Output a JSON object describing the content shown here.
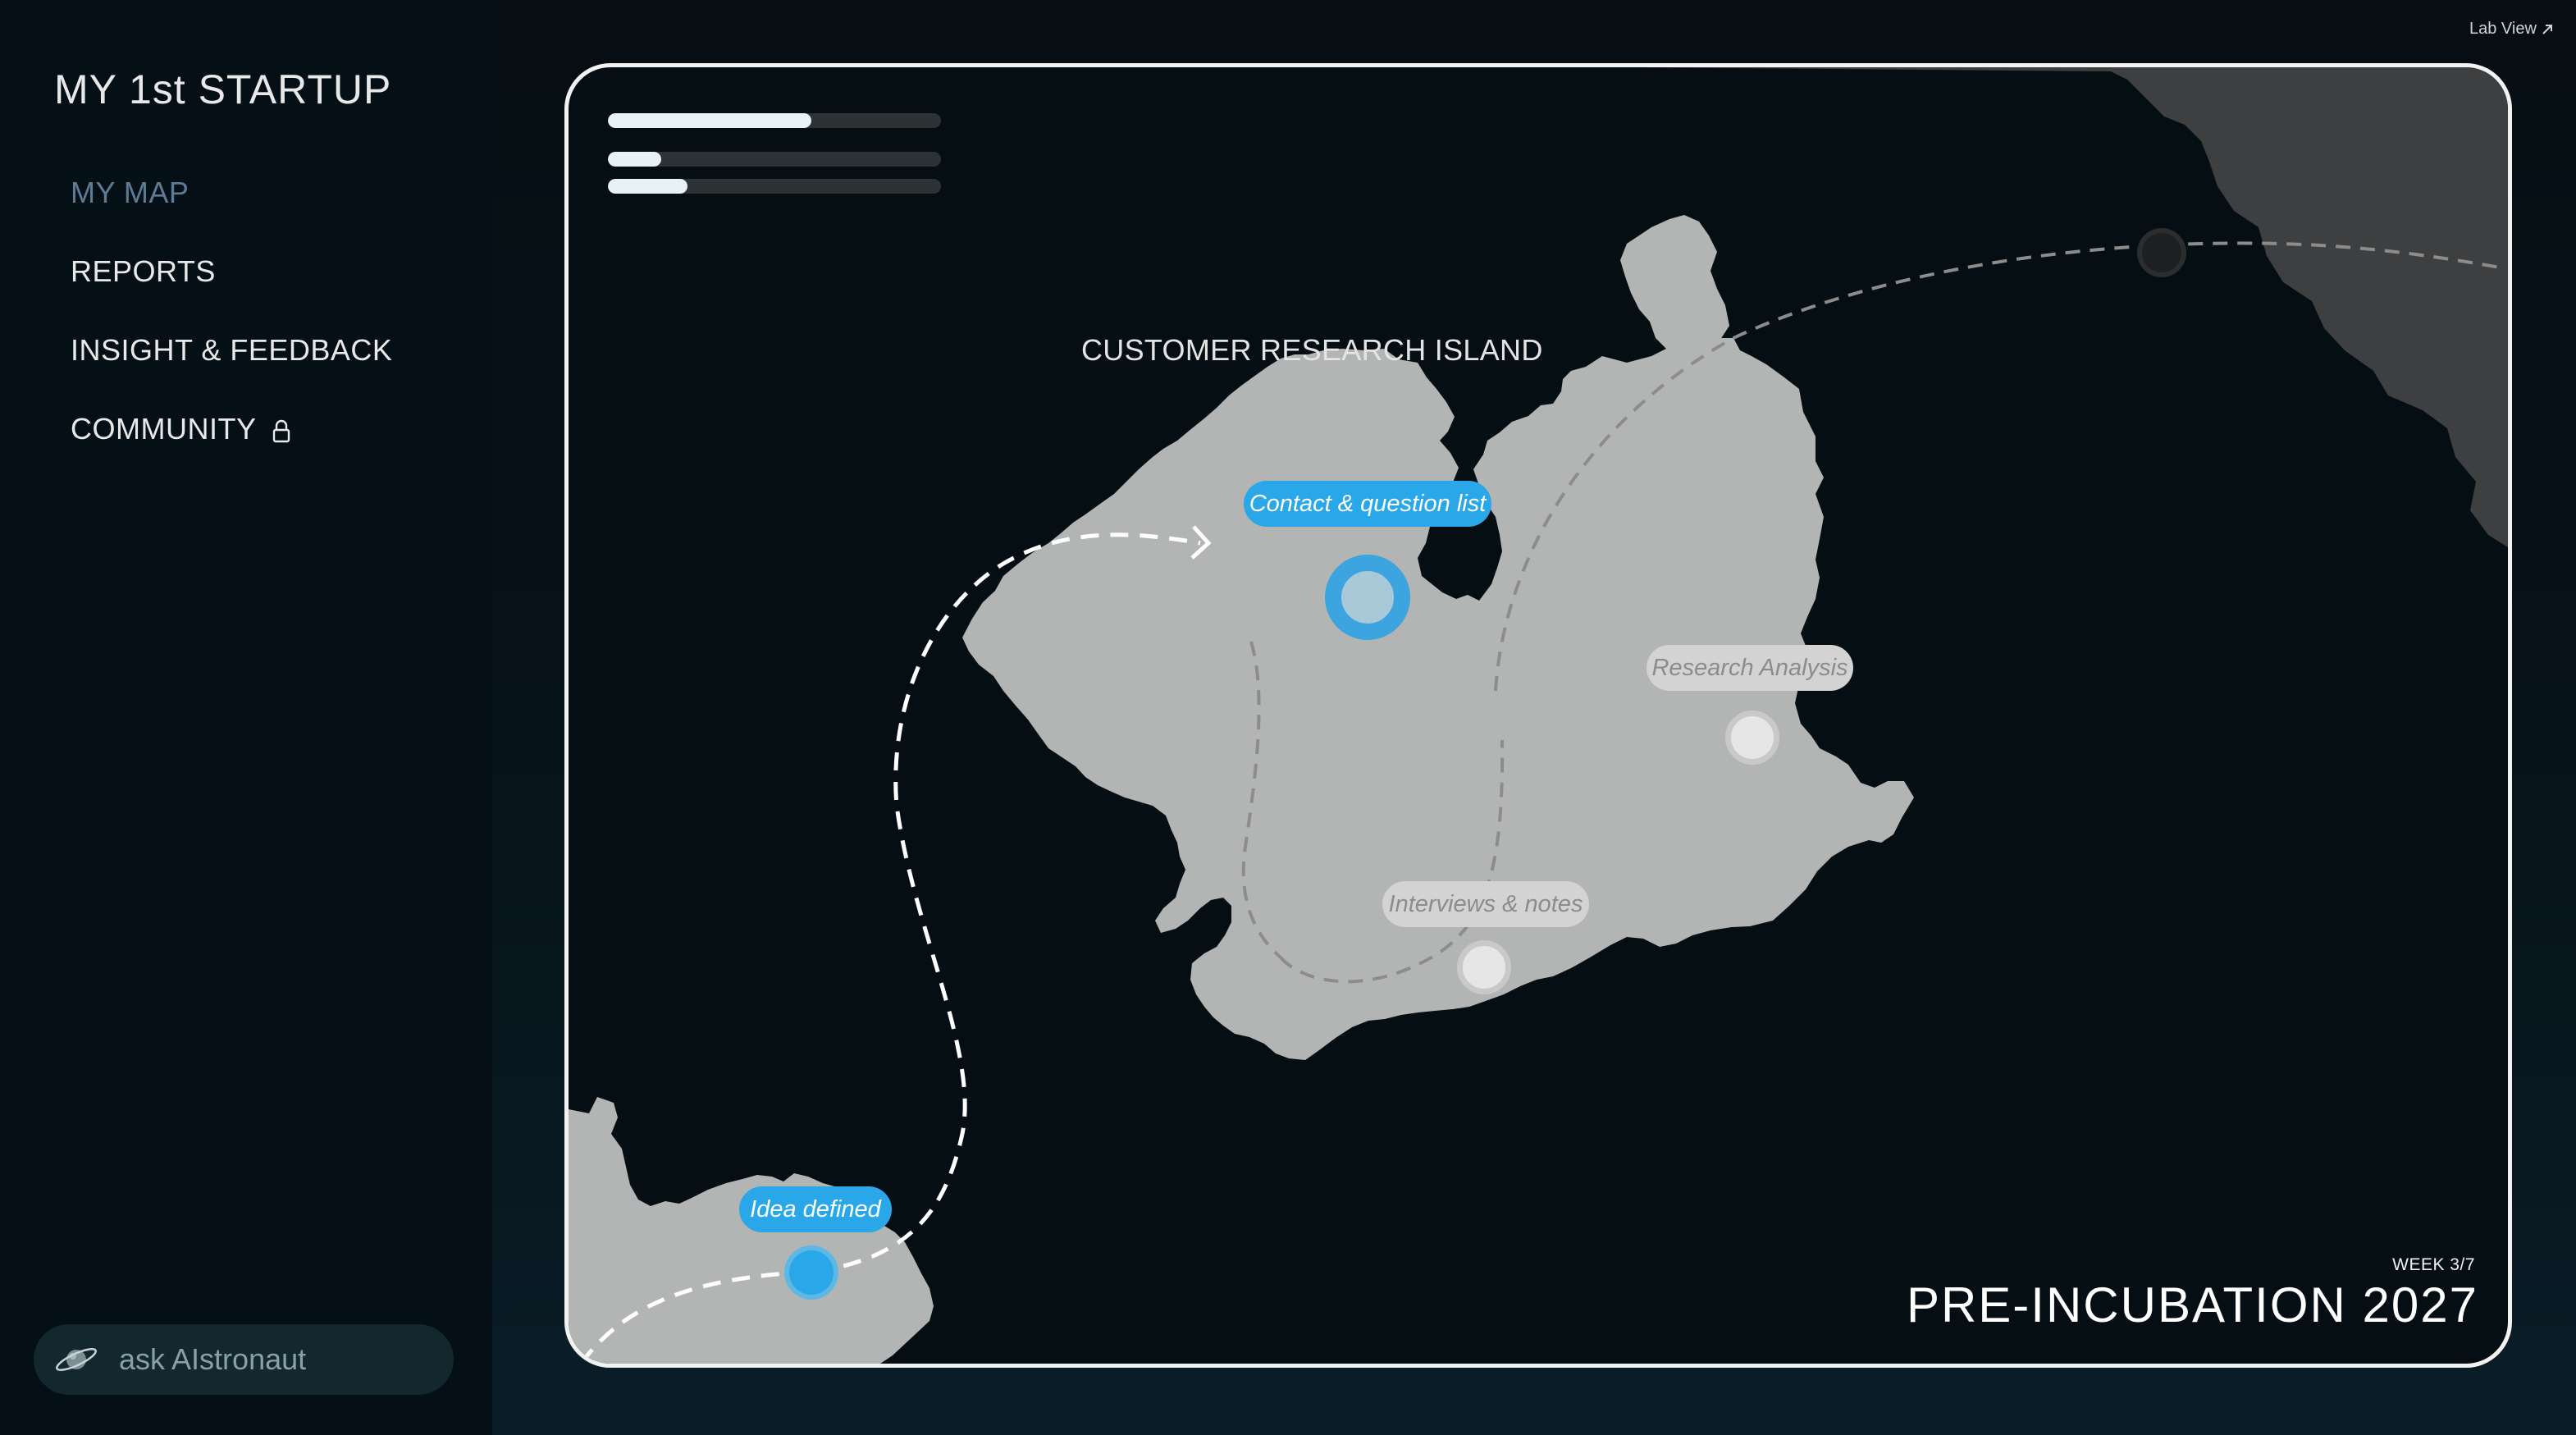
{
  "sidebar": {
    "brand": "MY 1st STARTUP",
    "items": [
      {
        "label": "MY MAP",
        "active": true
      },
      {
        "label": "REPORTS",
        "active": false
      },
      {
        "label": "INSIGHT & FEEDBACK",
        "active": false
      },
      {
        "label": "COMMUNITY",
        "active": false,
        "locked": true
      }
    ],
    "ask": {
      "placeholder": "ask AIstronaut",
      "icon": "planet-icon"
    }
  },
  "header": {
    "lab_view": "Lab View",
    "lab_view_icon": "external-arrow-icon"
  },
  "map": {
    "progress": [
      0.61,
      0.16,
      0.24
    ],
    "island_title": "CUSTOMER RESEARCH ISLAND",
    "milestones": {
      "idea": {
        "label": "Idea defined",
        "state": "done"
      },
      "contact": {
        "label": "Contact & question list",
        "state": "current"
      },
      "research": {
        "label": "Research Analysis",
        "state": "locked"
      },
      "interviews": {
        "label": "Interviews & notes",
        "state": "locked"
      }
    },
    "week": "WEEK 3/7",
    "program": "PRE-INCUBATION 2027"
  },
  "colors": {
    "accent": "#2aa7e9",
    "island": "#b3b5b5",
    "background": "#050e12",
    "nav_active": "#5e7b96"
  }
}
